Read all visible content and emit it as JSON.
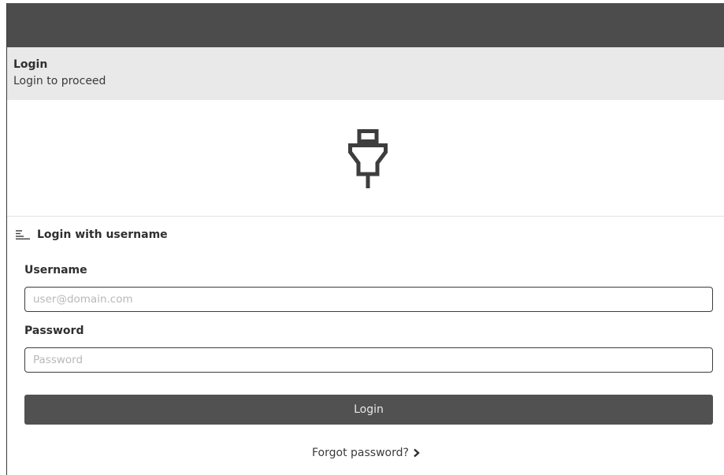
{
  "header": {
    "title": "Login",
    "subtitle": "Login to proceed"
  },
  "logo": {
    "icon": "plug-icon"
  },
  "login_section": {
    "icon": "list-icon",
    "title": "Login with username",
    "username": {
      "label": "Username",
      "value": "",
      "placeholder": "user@domain.com"
    },
    "password": {
      "label": "Password",
      "value": "",
      "placeholder": "Password"
    },
    "submit_label": "Login",
    "forgot_label": "Forgot password?",
    "forgot_icon": "chevron-right-icon"
  },
  "colors": {
    "topbar": "#4c4c4c",
    "header_band": "#e9e9e9",
    "button": "#515151"
  }
}
